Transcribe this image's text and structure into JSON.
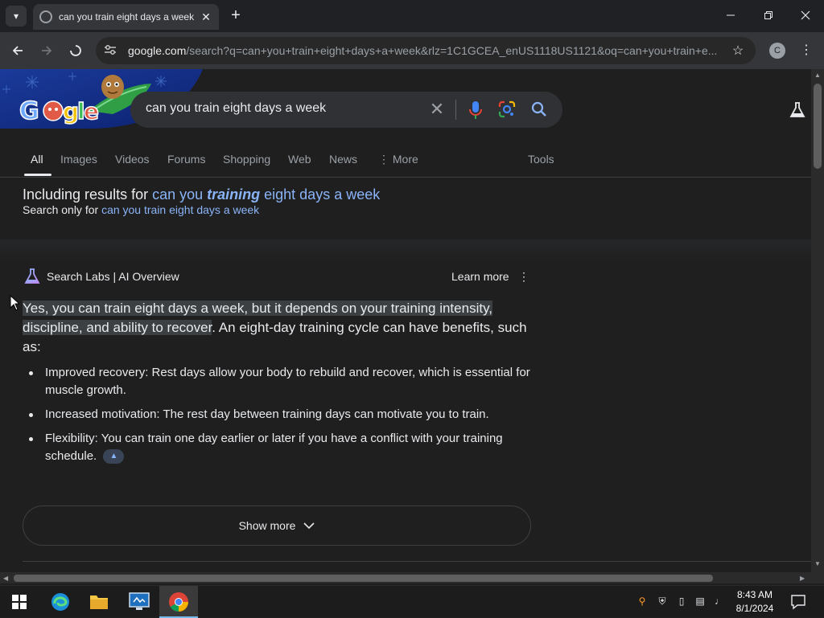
{
  "browser": {
    "tab_title": "can you train eight days a week",
    "new_tab_symbol": "+",
    "url_host": "google.com",
    "url_path": "/search?q=can+you+train+eight+days+a+week&rlz=1C1GCEA_enUS1118US1121&oq=can+you+train+e...",
    "profile_initial": "C"
  },
  "search": {
    "query": "can you train eight days a week",
    "tabs": [
      "All",
      "Images",
      "Videos",
      "Forums",
      "Shopping",
      "Web",
      "News",
      "More"
    ],
    "active_tab": "All",
    "tools_label": "Tools"
  },
  "spelling": {
    "including_prefix": "Including results for",
    "including_pre": "can you ",
    "including_emph": "training",
    "including_post": " eight days a week",
    "search_only_prefix": "Search only for",
    "search_only_link": "can you train eight days a week"
  },
  "ai_overview": {
    "label": "Search Labs | AI Overview",
    "learn_more": "Learn more",
    "highlight": "Yes, you can train eight days a week, but it depends on your training intensity, discipline, and ability to recover",
    "rest": ". An eight-day training cycle can have benefits, such as:",
    "bullets": [
      "Improved recovery: Rest days allow your body to rebuild and recover, which is essential for muscle growth.",
      "Increased motivation: The rest day between training days can motivate you to train.",
      "Flexibility: You can train one day earlier or later if you have a conflict with your training schedule."
    ],
    "show_more": "Show more"
  },
  "taskbar": {
    "time": "8:43 AM",
    "date": "8/1/2024"
  },
  "colors": {
    "link": "#8ab4f8",
    "background": "#1f1f1f",
    "text": "#e8eaed",
    "muted": "#9aa0a6"
  },
  "icons": [
    "tab-list-icon",
    "close-icon",
    "plus-icon",
    "minimize-icon",
    "restore-icon",
    "back-icon",
    "forward-icon",
    "stop-icon",
    "site-info-icon",
    "bookmark-star-icon",
    "kebab-menu-icon",
    "microphone-icon",
    "google-lens-icon",
    "search-icon",
    "labs-flask-icon",
    "windows-start-icon",
    "edge-icon",
    "file-explorer-icon",
    "chrome-icon"
  ]
}
